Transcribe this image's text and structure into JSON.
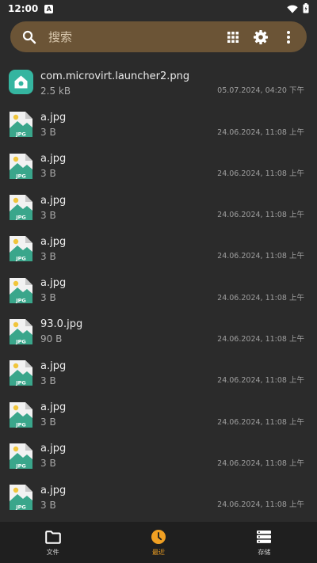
{
  "status_bar": {
    "time": "12:00",
    "notification_letter": "A"
  },
  "search": {
    "placeholder": "搜索"
  },
  "files": [
    {
      "name": "com.microvirt.launcher2.png",
      "size": "2.5 kB",
      "date": "05.07.2024, 04:20 下午",
      "icon": "app-icon"
    },
    {
      "name": "a.jpg",
      "size": "3 B",
      "date": "24.06.2024, 11:08 上午",
      "icon": "jpg-icon"
    },
    {
      "name": "a.jpg",
      "size": "3 B",
      "date": "24.06.2024, 11:08 上午",
      "icon": "jpg-icon"
    },
    {
      "name": "a.jpg",
      "size": "3 B",
      "date": "24.06.2024, 11:08 上午",
      "icon": "jpg-icon"
    },
    {
      "name": "a.jpg",
      "size": "3 B",
      "date": "24.06.2024, 11:08 上午",
      "icon": "jpg-icon"
    },
    {
      "name": "a.jpg",
      "size": "3 B",
      "date": "24.06.2024, 11:08 上午",
      "icon": "jpg-icon"
    },
    {
      "name": "93.0.jpg",
      "size": "90 B",
      "date": "24.06.2024, 11:08 上午",
      "icon": "jpg-icon"
    },
    {
      "name": "a.jpg",
      "size": "3 B",
      "date": "24.06.2024, 11:08 上午",
      "icon": "jpg-icon"
    },
    {
      "name": "a.jpg",
      "size": "3 B",
      "date": "24.06.2024, 11:08 上午",
      "icon": "jpg-icon"
    },
    {
      "name": "a.jpg",
      "size": "3 B",
      "date": "24.06.2024, 11:08 上午",
      "icon": "jpg-icon"
    },
    {
      "name": "a.jpg",
      "size": "3 B",
      "date": "24.06.2024, 11:08 上午",
      "icon": "jpg-icon"
    }
  ],
  "jpg_badge_text": "JPG",
  "bottom_nav": {
    "files_label": "文件",
    "recent_label": "最近",
    "storage_label": "存储"
  },
  "colors": {
    "accent": "#f0a023",
    "search_bg": "#6b5436",
    "background": "#2b2b2b",
    "jpg_green": "#3aa68b"
  }
}
